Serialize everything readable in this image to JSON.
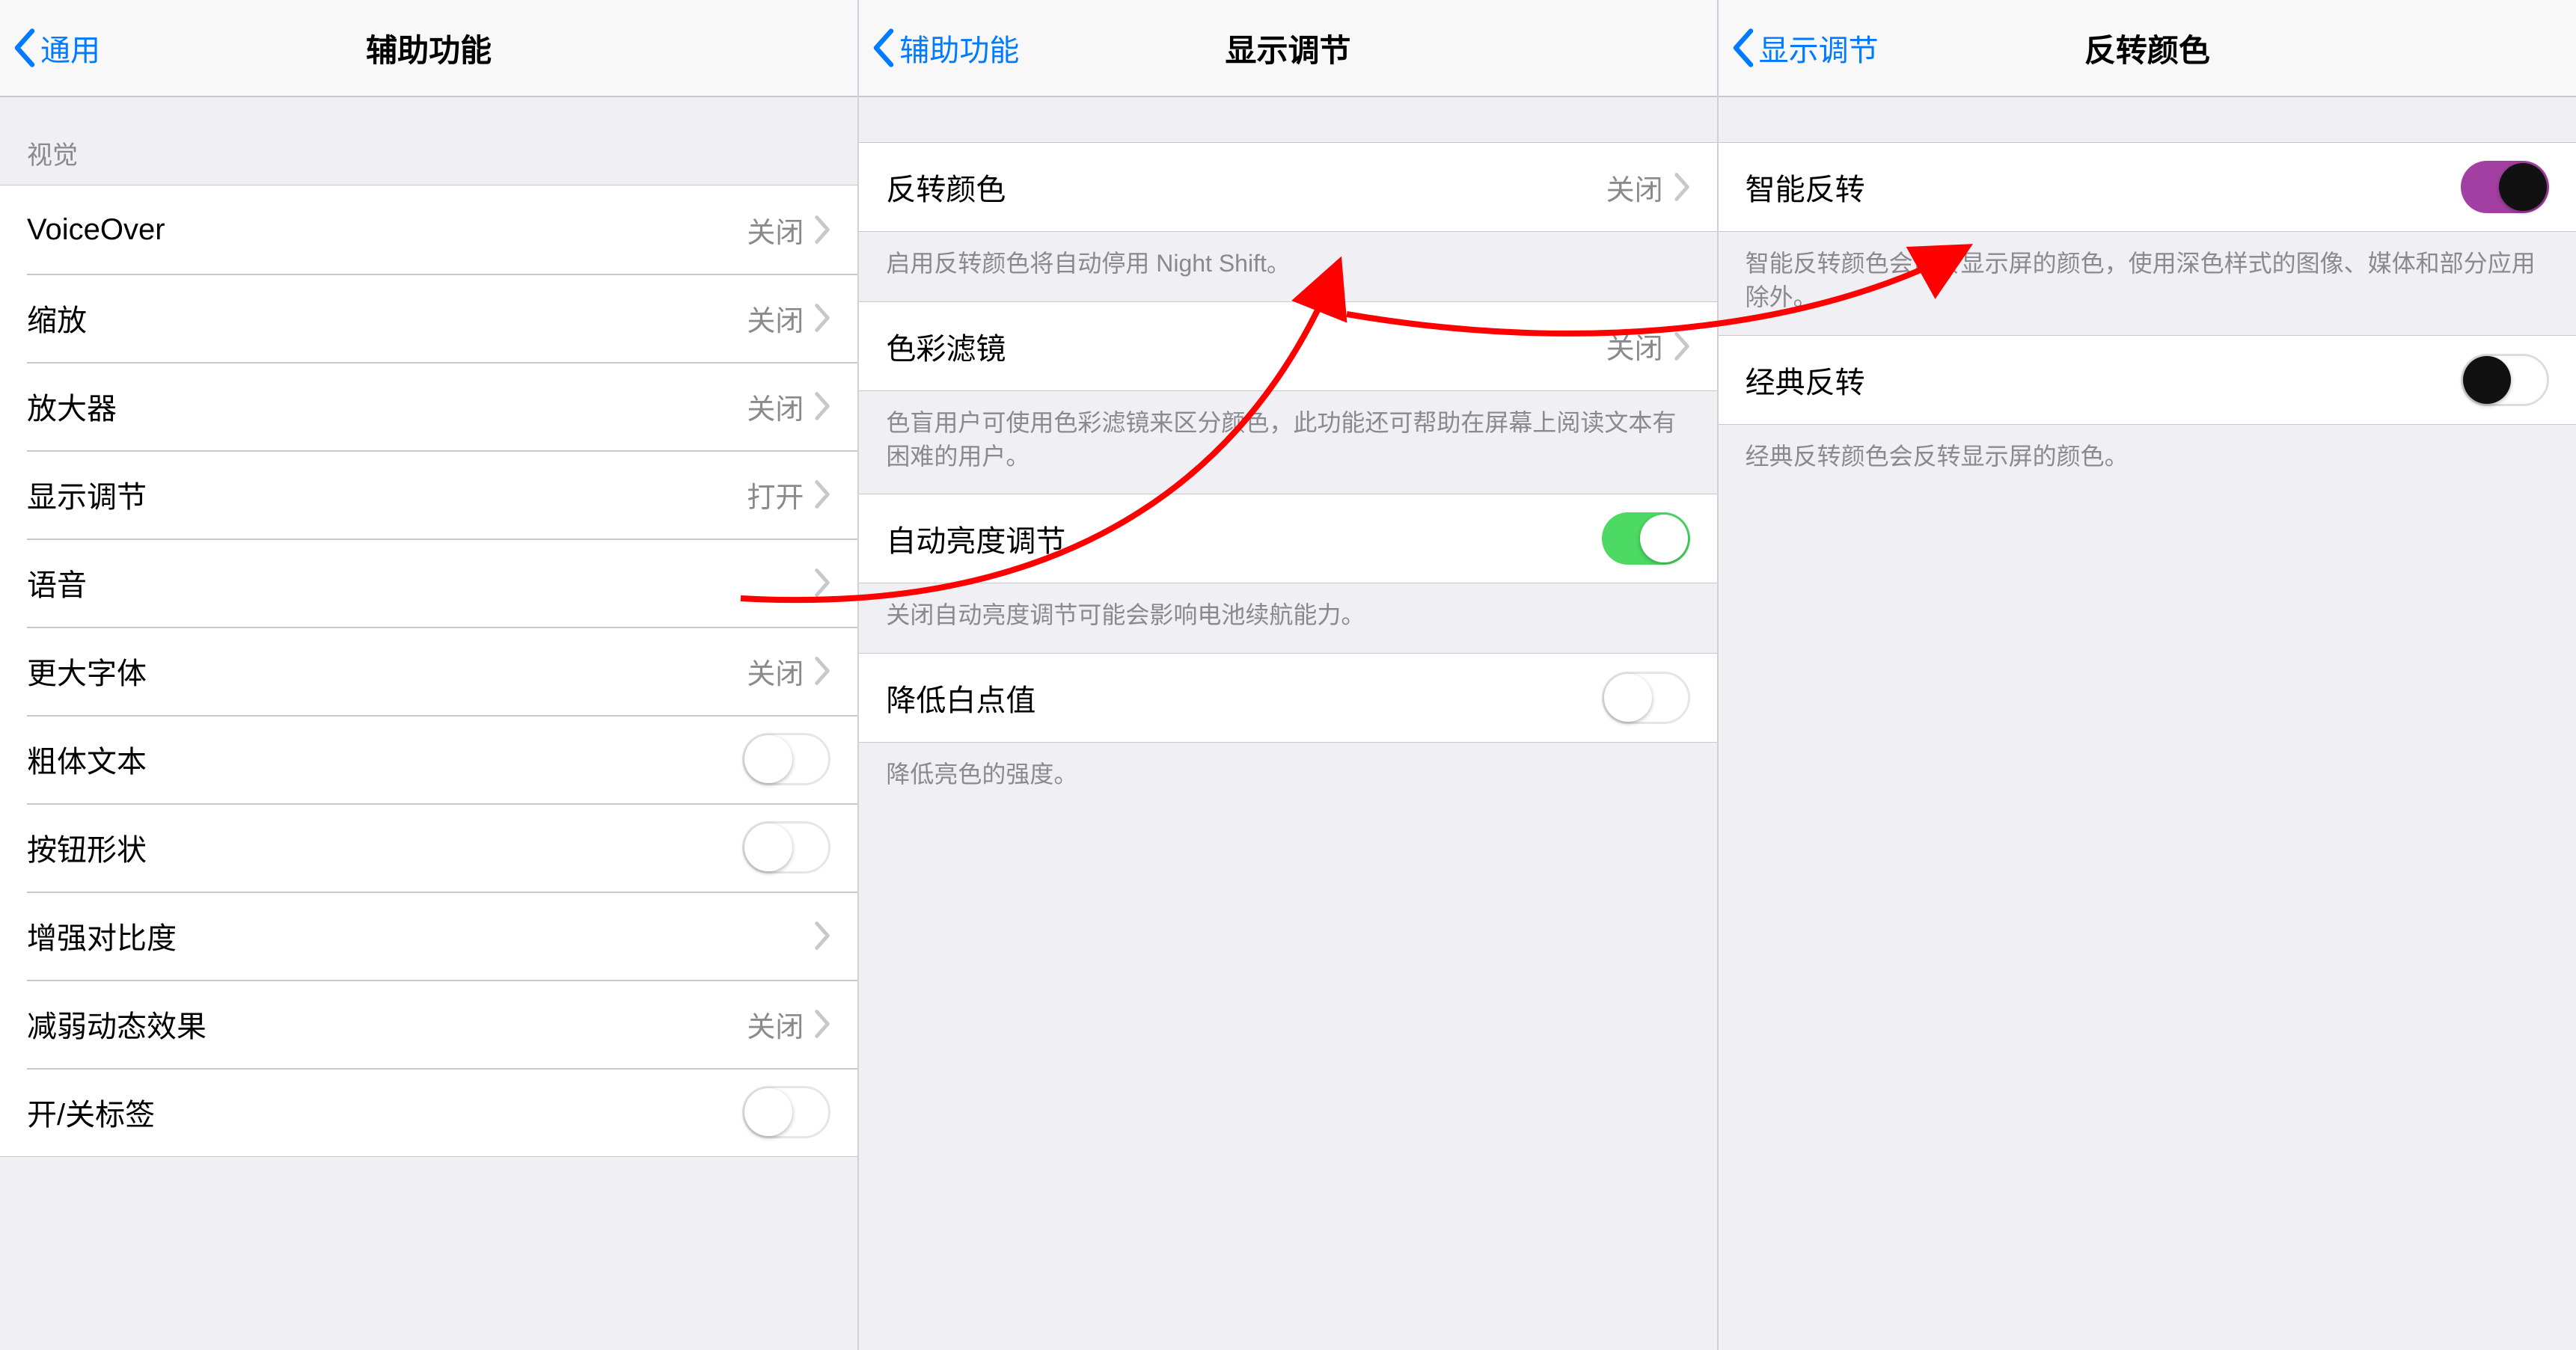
{
  "panel1": {
    "back_label": "通用",
    "title": "辅助功能",
    "section_header": "视觉",
    "rows": {
      "voiceover": {
        "label": "VoiceOver",
        "value": "关闭"
      },
      "zoom": {
        "label": "缩放",
        "value": "关闭"
      },
      "magnifier": {
        "label": "放大器",
        "value": "关闭"
      },
      "display": {
        "label": "显示调节",
        "value": "打开"
      },
      "speech": {
        "label": "语音",
        "value": ""
      },
      "larger_text": {
        "label": "更大字体",
        "value": "关闭"
      },
      "bold_text": {
        "label": "粗体文本"
      },
      "button_shapes": {
        "label": "按钮形状"
      },
      "increase_contrast": {
        "label": "增强对比度",
        "value": ""
      },
      "reduce_motion": {
        "label": "减弱动态效果",
        "value": "关闭"
      },
      "on_off_labels": {
        "label": "开/关标签"
      }
    }
  },
  "panel2": {
    "back_label": "辅助功能",
    "title": "显示调节",
    "rows": {
      "invert_colors": {
        "label": "反转颜色",
        "value": "关闭"
      },
      "color_filters": {
        "label": "色彩滤镜",
        "value": "关闭"
      },
      "auto_brightness": {
        "label": "自动亮度调节"
      },
      "reduce_white_point": {
        "label": "降低白点值"
      }
    },
    "footers": {
      "invert": "启用反转颜色将自动停用 Night Shift。",
      "color_filters": "色盲用户可使用色彩滤镜来区分颜色，此功能还可帮助在屏幕上阅读文本有困难的用户。",
      "auto_brightness": "关闭自动亮度调节可能会影响电池续航能力。",
      "reduce_white_point": "降低亮色的强度。"
    }
  },
  "panel3": {
    "back_label": "显示调节",
    "title": "反转颜色",
    "rows": {
      "smart_invert": {
        "label": "智能反转"
      },
      "classic_invert": {
        "label": "经典反转"
      }
    },
    "footers": {
      "smart": "智能反转颜色会反转显示屏的颜色，使用深色样式的图像、媒体和部分应用除外。",
      "classic": "经典反转颜色会反转显示屏的颜色。"
    }
  }
}
